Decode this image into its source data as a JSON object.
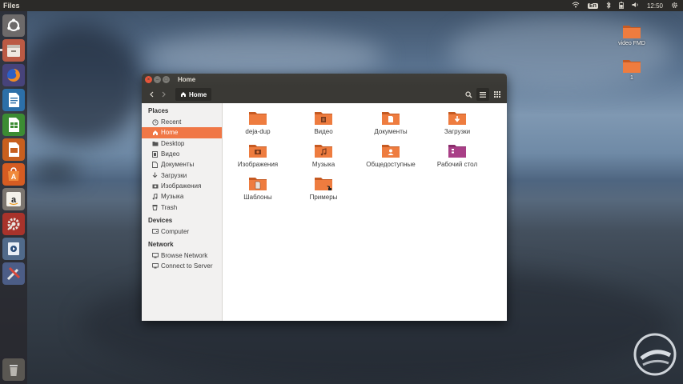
{
  "topbar": {
    "app_name": "Files",
    "keyboard": "En",
    "clock": "12:50"
  },
  "launcher": {
    "items": [
      {
        "name": "ubuntu-dash-icon"
      },
      {
        "name": "files-icon"
      },
      {
        "name": "firefox-icon"
      },
      {
        "name": "writer-icon"
      },
      {
        "name": "calc-icon"
      },
      {
        "name": "impress-icon"
      },
      {
        "name": "software-center-icon"
      },
      {
        "name": "amazon-icon"
      },
      {
        "name": "system-settings-icon"
      },
      {
        "name": "video-player-icon"
      },
      {
        "name": "tweak-tool-icon"
      },
      {
        "name": "trash-icon"
      }
    ]
  },
  "desktop": {
    "icons": [
      {
        "label": "video FMD"
      },
      {
        "label": "1"
      }
    ]
  },
  "window": {
    "title": "Home",
    "breadcrumb": "Home",
    "sidebar": {
      "places_title": "Places",
      "places": [
        "Recent",
        "Home",
        "Desktop",
        "Видео",
        "Документы",
        "Загрузки",
        "Изображения",
        "Музыка",
        "Trash"
      ],
      "devices_title": "Devices",
      "devices": [
        "Computer"
      ],
      "network_title": "Network",
      "network": [
        "Browse Network",
        "Connect to Server"
      ]
    },
    "files": [
      "deja-dup",
      "Видео",
      "Документы",
      "Загрузки",
      "Изображения",
      "Музыка",
      "Общедоступные",
      "Рабочий стол",
      "Шаблоны",
      "Примеры"
    ]
  },
  "colors": {
    "accent": "#f07746",
    "folder": "#e9763b",
    "titlebar": "#3a3935"
  }
}
